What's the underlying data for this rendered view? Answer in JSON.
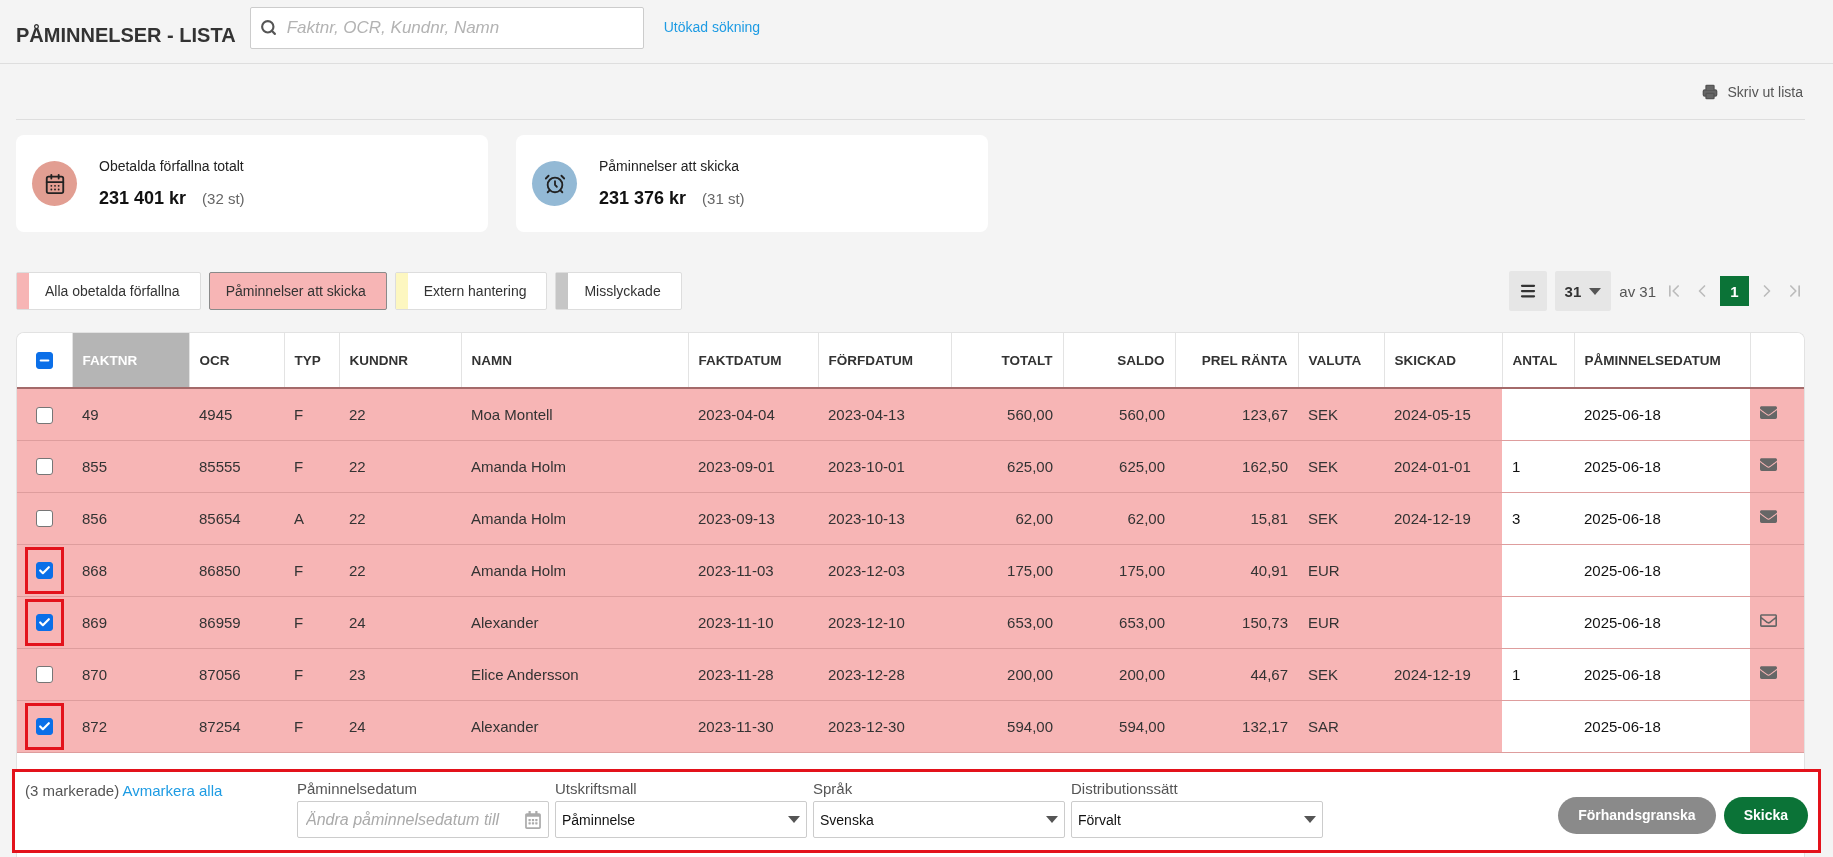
{
  "header": {
    "title": "PÅMINNELSER - LISTA",
    "search": {
      "placeholder": "Faktnr, OCR, Kundnr, Namn"
    },
    "advanced_link": "Utökad sökning"
  },
  "toolbar": {
    "print": "Skriv ut lista"
  },
  "cards": [
    {
      "kind": "calendar",
      "color": "#e29e92",
      "label": "Obetalda förfallna totalt",
      "amount": "231 401 kr",
      "count": "(32 st)"
    },
    {
      "kind": "alarm",
      "color": "#93b9d5",
      "label": "Påminnelser att skicka",
      "amount": "231 376 kr",
      "count": "(31 st)"
    }
  ],
  "filters": [
    {
      "label": "Alla obetalda förfallna",
      "color": "#f7b5b5",
      "selected": false
    },
    {
      "label": "Påminnelser att skicka",
      "color": "#f7b5b5",
      "selected": true
    },
    {
      "label": "Extern hantering",
      "color": "#fdf7c0",
      "selected": false
    },
    {
      "label": "Misslyckade",
      "color": "#c6c6c6",
      "selected": false
    }
  ],
  "pagination": {
    "page_size": "31",
    "total": "av 31",
    "pages": [
      {
        "label": "1",
        "selected": true
      }
    ]
  },
  "table": {
    "header_checkbox": {
      "indeterminate": true
    },
    "columns": [
      {
        "label": "FAKTNR",
        "kind": "text",
        "sorted": true
      },
      {
        "label": "OCR",
        "kind": "text",
        "sorted": false
      },
      {
        "label": "TYP",
        "kind": "text",
        "sorted": false
      },
      {
        "label": "KUNDNR",
        "kind": "text",
        "sorted": false
      },
      {
        "label": "NAMN",
        "kind": "text",
        "sorted": false
      },
      {
        "label": "FAKTDATUM",
        "kind": "text",
        "sorted": false
      },
      {
        "label": "FÖRFDATUM",
        "kind": "text",
        "sorted": false
      },
      {
        "label": "TOTALT",
        "kind": "number",
        "sorted": false
      },
      {
        "label": "SALDO",
        "kind": "number",
        "sorted": false
      },
      {
        "label": "PREL RÄNTA",
        "kind": "number",
        "sorted": false
      },
      {
        "label": "VALUTA",
        "kind": "text",
        "sorted": false
      },
      {
        "label": "SKICKAD",
        "kind": "text",
        "sorted": false
      },
      {
        "label": "ANTAL",
        "kind": "input",
        "sorted": false
      },
      {
        "label": "PÅMINNELSEDATUM",
        "kind": "input",
        "sorted": false
      }
    ],
    "rows": [
      {
        "checked": false,
        "highlighted": false,
        "mail_icon": true,
        "mail_outline": false,
        "cells": [
          "49",
          "4945",
          "F",
          "22",
          "Moa Montell",
          "2023-04-04",
          "2023-04-13",
          "560,00",
          "560,00",
          "123,67",
          "SEK",
          "2024-05-15",
          null,
          "2025-06-18"
        ]
      },
      {
        "checked": false,
        "highlighted": false,
        "mail_icon": true,
        "mail_outline": false,
        "cells": [
          "855",
          "85555",
          "F",
          "22",
          "Amanda Holm",
          "2023-09-01",
          "2023-10-01",
          "625,00",
          "625,00",
          "162,50",
          "SEK",
          "2024-01-01",
          "1",
          "2025-06-18"
        ]
      },
      {
        "checked": false,
        "highlighted": false,
        "mail_icon": true,
        "mail_outline": false,
        "cells": [
          "856",
          "85654",
          "A",
          "22",
          "Amanda Holm",
          "2023-09-13",
          "2023-10-13",
          "62,00",
          "62,00",
          "15,81",
          "SEK",
          "2024-12-19",
          "3",
          "2025-06-18"
        ]
      },
      {
        "checked": true,
        "highlighted": true,
        "mail_icon": false,
        "cells": [
          "868",
          "86850",
          "F",
          "22",
          "Amanda Holm",
          "2023-11-03",
          "2023-12-03",
          "175,00",
          "175,00",
          "40,91",
          "EUR",
          null,
          null,
          "2025-06-18"
        ]
      },
      {
        "checked": true,
        "highlighted": true,
        "mail_icon": true,
        "mail_outline": true,
        "cells": [
          "869",
          "86959",
          "F",
          "24",
          "Alexander",
          "2023-11-10",
          "2023-12-10",
          "653,00",
          "653,00",
          "150,73",
          "EUR",
          null,
          null,
          "2025-06-18"
        ]
      },
      {
        "checked": false,
        "highlighted": false,
        "mail_icon": true,
        "mail_outline": false,
        "cells": [
          "870",
          "87056",
          "F",
          "23",
          "Elice Andersson",
          "2023-11-28",
          "2023-12-28",
          "200,00",
          "200,00",
          "44,67",
          "SEK",
          "2024-12-19",
          "1",
          "2025-06-18"
        ]
      },
      {
        "checked": true,
        "highlighted": true,
        "mail_icon": false,
        "cells": [
          "872",
          "87254",
          "F",
          "24",
          "Alexander",
          "2023-11-30",
          "2023-12-30",
          "594,00",
          "594,00",
          "132,17",
          "SAR",
          null,
          null,
          "2025-06-18"
        ]
      }
    ]
  },
  "bottom_bar": {
    "highlighted": true,
    "selection_count": "(3 markerade)",
    "clear_link": "Avmarkera alla",
    "fields": [
      {
        "kind": "date",
        "label": "Påminnelsedatum",
        "placeholder": "Ändra påminnelsedatum till"
      },
      {
        "kind": "select",
        "label": "Utskriftsmall",
        "value": "Påminnelse"
      },
      {
        "kind": "select",
        "label": "Språk",
        "value": "Svenska"
      },
      {
        "kind": "select",
        "label": "Distributionssätt",
        "value": "Förvalt"
      }
    ],
    "buttons": [
      {
        "label": "Förhandsgranska",
        "kind": "secondary"
      },
      {
        "label": "Skicka",
        "kind": "primary"
      }
    ]
  }
}
